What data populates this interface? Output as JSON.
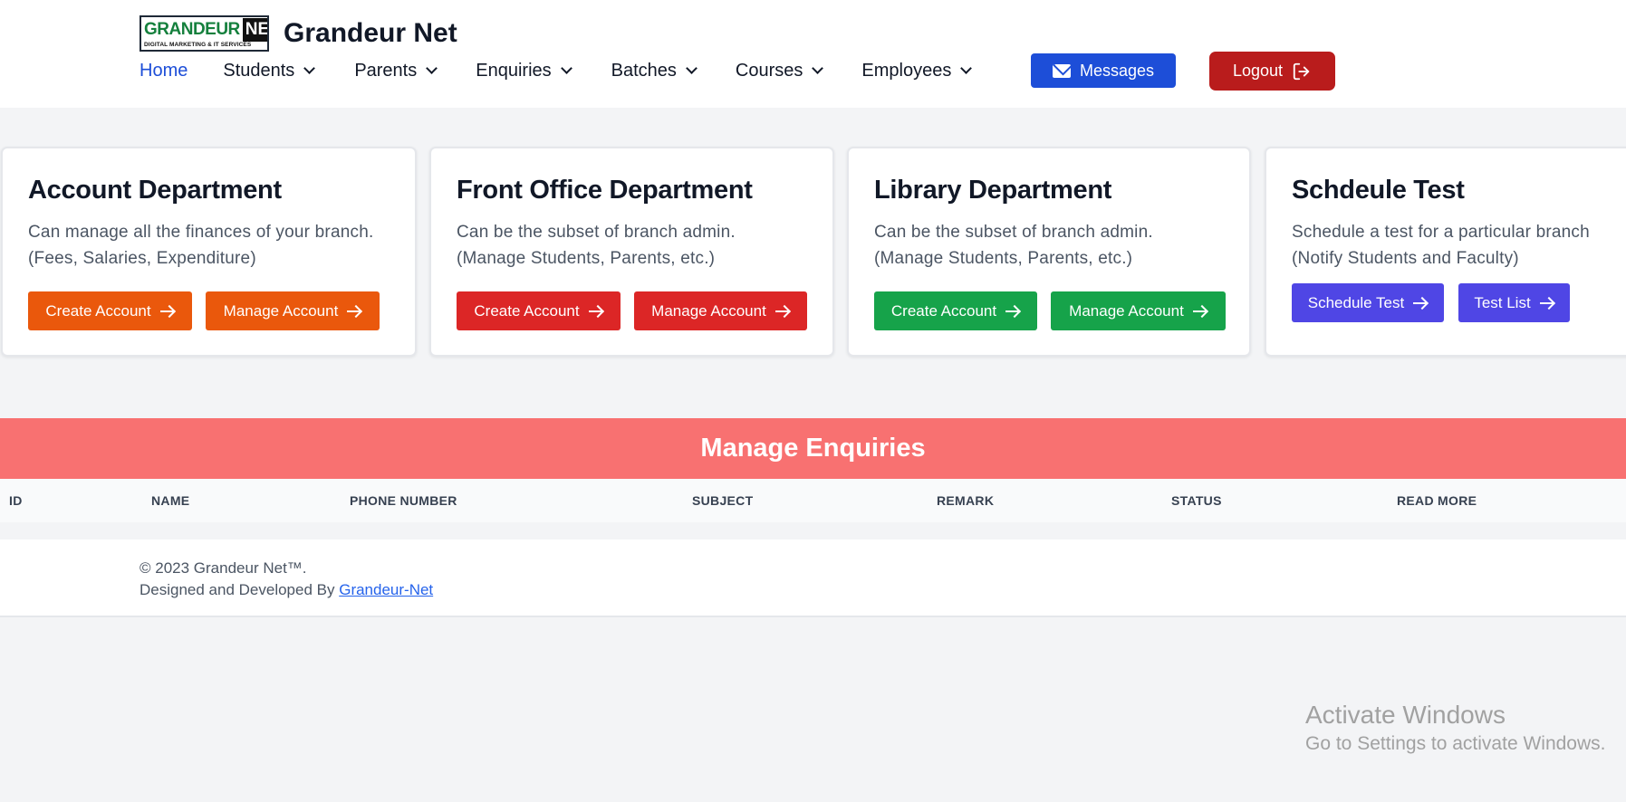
{
  "brand": {
    "logo_word": "GRANDEUR",
    "logo_net": "NET",
    "logo_tagline": "DIGITAL MARKETING & IT SERVICES",
    "name": "Grandeur Net"
  },
  "nav": {
    "home": "Home",
    "students": "Students",
    "parents": "Parents",
    "enquiries": "Enquiries",
    "batches": "Batches",
    "courses": "Courses",
    "employees": "Employees",
    "messages": "Messages",
    "logout": "Logout"
  },
  "cards": {
    "account": {
      "title": "Account Department",
      "desc1": "Can manage all the finances of your branch.",
      "desc2": "(Fees, Salaries, Expenditure)",
      "btn1": "Create Account",
      "btn2": "Manage Account"
    },
    "front_office": {
      "title": "Front Office Department",
      "desc1": "Can be the subset of branch admin.",
      "desc2": "(Manage Students, Parents, etc.)",
      "btn1": "Create Account",
      "btn2": "Manage Account"
    },
    "library": {
      "title": "Library Department",
      "desc1": "Can be the subset of branch admin.",
      "desc2": "(Manage Students, Parents, etc.)",
      "btn1": "Create Account",
      "btn2": "Manage Account"
    },
    "schedule": {
      "title": "Schdeule Test",
      "desc1": "Schedule a test for a particular branch",
      "desc2": "(Notify Students and Faculty)",
      "btn1": "Schedule Test",
      "btn2": "Test List"
    }
  },
  "enquiries": {
    "title": "Manage Enquiries",
    "columns": [
      "ID",
      "NAME",
      "PHONE NUMBER",
      "SUBJECT",
      "REMARK",
      "STATUS",
      "READ MORE"
    ]
  },
  "footer": {
    "copyright": "© 2023 Grandeur Net™.",
    "designed_by": "Designed and Developed By",
    "link": "Grandeur-Net"
  },
  "watermark": {
    "line1": "Activate Windows",
    "line2": "Go to Settings to activate Windows."
  },
  "colors": {
    "primary": "#1d4ed8",
    "logout": "#b91c1c",
    "orange": "#ea580c",
    "red": "#dc2626",
    "green": "#16a34a",
    "indigo": "#4f46e5",
    "enquiries_header": "#f87171"
  }
}
